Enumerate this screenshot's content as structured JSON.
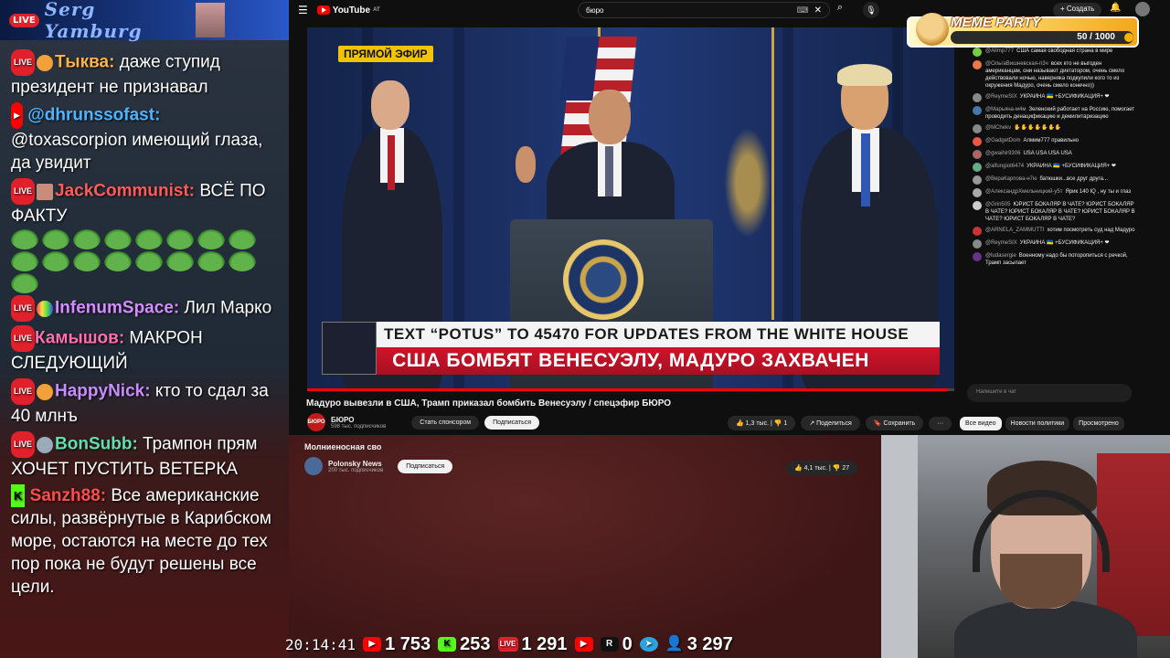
{
  "left_chat": {
    "streamer": "Serg Yamburg",
    "live_badge": "LIVE",
    "messages": [
      {
        "user": "Тыква:",
        "text": " даже ступид президент не признавал",
        "color": "#ffb347",
        "badge": "live"
      },
      {
        "user": "@dhrunssofast:",
        "text": " @toxascorpion имеющий глаза, да увидит",
        "color": "#4fb3ff",
        "badge": "youtube"
      },
      {
        "user": "JackCommunist:",
        "text": " ВСЁ ПО ФАКТУ",
        "color": "#ff5a5a",
        "badge": "live"
      },
      {
        "user": "InfenumSpace:",
        "text": " Лил Марко",
        "color": "#d58cff",
        "badge": "live"
      },
      {
        "user": "Камышов:",
        "text": " МАКРОН СЛЕДУЮЩИЙ",
        "color": "#ff6fae",
        "badge": "live"
      },
      {
        "user": "HappyNick:",
        "text": " кто то сдал за 40 млнъ",
        "color": "#c88cff",
        "badge": "live"
      },
      {
        "user": "BonSubb:",
        "text": " Трампон прям ХОЧЕТ ПУСТИТЬ ВЕТЕРКА",
        "color": "#5ee0b0",
        "badge": "live"
      },
      {
        "user": "Sanzh88:",
        "text": " Все американские силы, развёрнутые в Карибском море, остаются на месте до тех пор пока не будут решены все цели.",
        "color": "#ff4d4d",
        "badge": "kick"
      }
    ],
    "kick_badge": "K"
  },
  "yt": {
    "logo": "YouTube",
    "region": "AT",
    "search_value": "бюро",
    "create_label": "Создать",
    "video": {
      "live_tag": "ПРЯМОЙ ЭФИР",
      "lower_top": "TEXT “POTUS” TO 45470 FOR UPDATES FROM THE WHITE HOUSE",
      "lower_bottom": "США БОМБЯТ ВЕНЕСУЭЛУ, МАДУРО ЗАХВАЧЕН",
      "progress": 0.99
    },
    "title": "Мадуро вывезли в США, Трамп приказал бомбить Венесуэлу / спецэфир БЮРО",
    "channel": {
      "name": "БЮРО",
      "subs": "598 тыс. подписчиков",
      "avatar_text": "БЮРО"
    },
    "sponsor_label": "Стать спонсором",
    "subscribe_label": "Подписаться",
    "likes": "1,3 тыс.",
    "dislikes": "1",
    "share_label": "Поделиться",
    "save_label": "Сохранить",
    "more_label": "···",
    "tabs": [
      "Все видео",
      "Новости политики",
      "Просмотрено"
    ],
    "feed": {
      "title": "Молниеносная сво",
      "channel": "Polonsky News",
      "subs": "200 тыс. подписчиков",
      "subscribe_label": "Подписаться",
      "likes": "4,1 тыс.",
      "dislikes": "27"
    },
    "chat": {
      "input_placeholder": "Напишите в чат",
      "messages": [
        {
          "author": "@Allmp777",
          "text": "США самая свободная страна в мире"
        },
        {
          "author": "@ОльгаВишневская-п3ч",
          "text": "всех кто не выгоден американцам, они называют диктатором, очень смело действовали ночью, наверняка подкупили кого то из окружения Мадуро, очень смело конечно))"
        },
        {
          "author": "@ReymeSIX",
          "text": "УКРАИНА 🇺🇦 +БУСИФИКАЦИЯ+ ❤"
        },
        {
          "author": "@Марьяна-м4м",
          "text": "Зеленский работает на Россию, помогает проводить денацификацию и демилитаризацию"
        },
        {
          "author": "@MChekv",
          "text": "✋✋✋✋✋✋✋"
        },
        {
          "author": "@GadgetDom",
          "text": "Алмим777 правильно"
        },
        {
          "author": "@gwaihir9306",
          "text": "USA USA USA USA"
        },
        {
          "author": "@alfungiot6474",
          "text": "УКРАИНА 🇺🇦 +БУСИФИКАЦИЯ+ ❤"
        },
        {
          "author": "@ВераКарпова-н7ю",
          "text": "батюшки...все друг друга..."
        },
        {
          "author": "@АлександрХмельницкий-у5т",
          "text": "Ярик 140 IQ , ну ты и глаз"
        },
        {
          "author": "@Grin505",
          "text": "ЮРИСТ БОКАЛЯР В ЧАТЕ? ЮРИСТ БОКАЛЯР В ЧАТЕ? ЮРИСТ БОКАЛЯР В ЧАТЕ? ЮРИСТ БОКАЛЯР В ЧАТЕ? ЮРИСТ БОКАЛЯР В ЧАТЕ?"
        },
        {
          "author": "@ARNELA_ZAMMUTTI",
          "text": "хотим посмотреть суд над Мадуро"
        },
        {
          "author": "@ReymeSIX",
          "text": "УКРАИНА 🇺🇦 +БУСИФИКАЦИЯ+ ❤"
        },
        {
          "author": "@ludasergie",
          "text": "Военному надо бы поторопиться с речкой, Трамп засыпает"
        }
      ]
    }
  },
  "meme_party": {
    "title": "MEME PARTY",
    "progress_text": "50 / 1000"
  },
  "stats": {
    "time": "20:14:41",
    "youtube": "1 753",
    "kick": "253",
    "vk": "1 291",
    "yt2": "",
    "rutube": "0",
    "telegram": "",
    "viewers": "3 297"
  },
  "colors": {
    "accent_red": "#ff0000",
    "live_red": "#e0202a",
    "kick_green": "#53fc18"
  }
}
